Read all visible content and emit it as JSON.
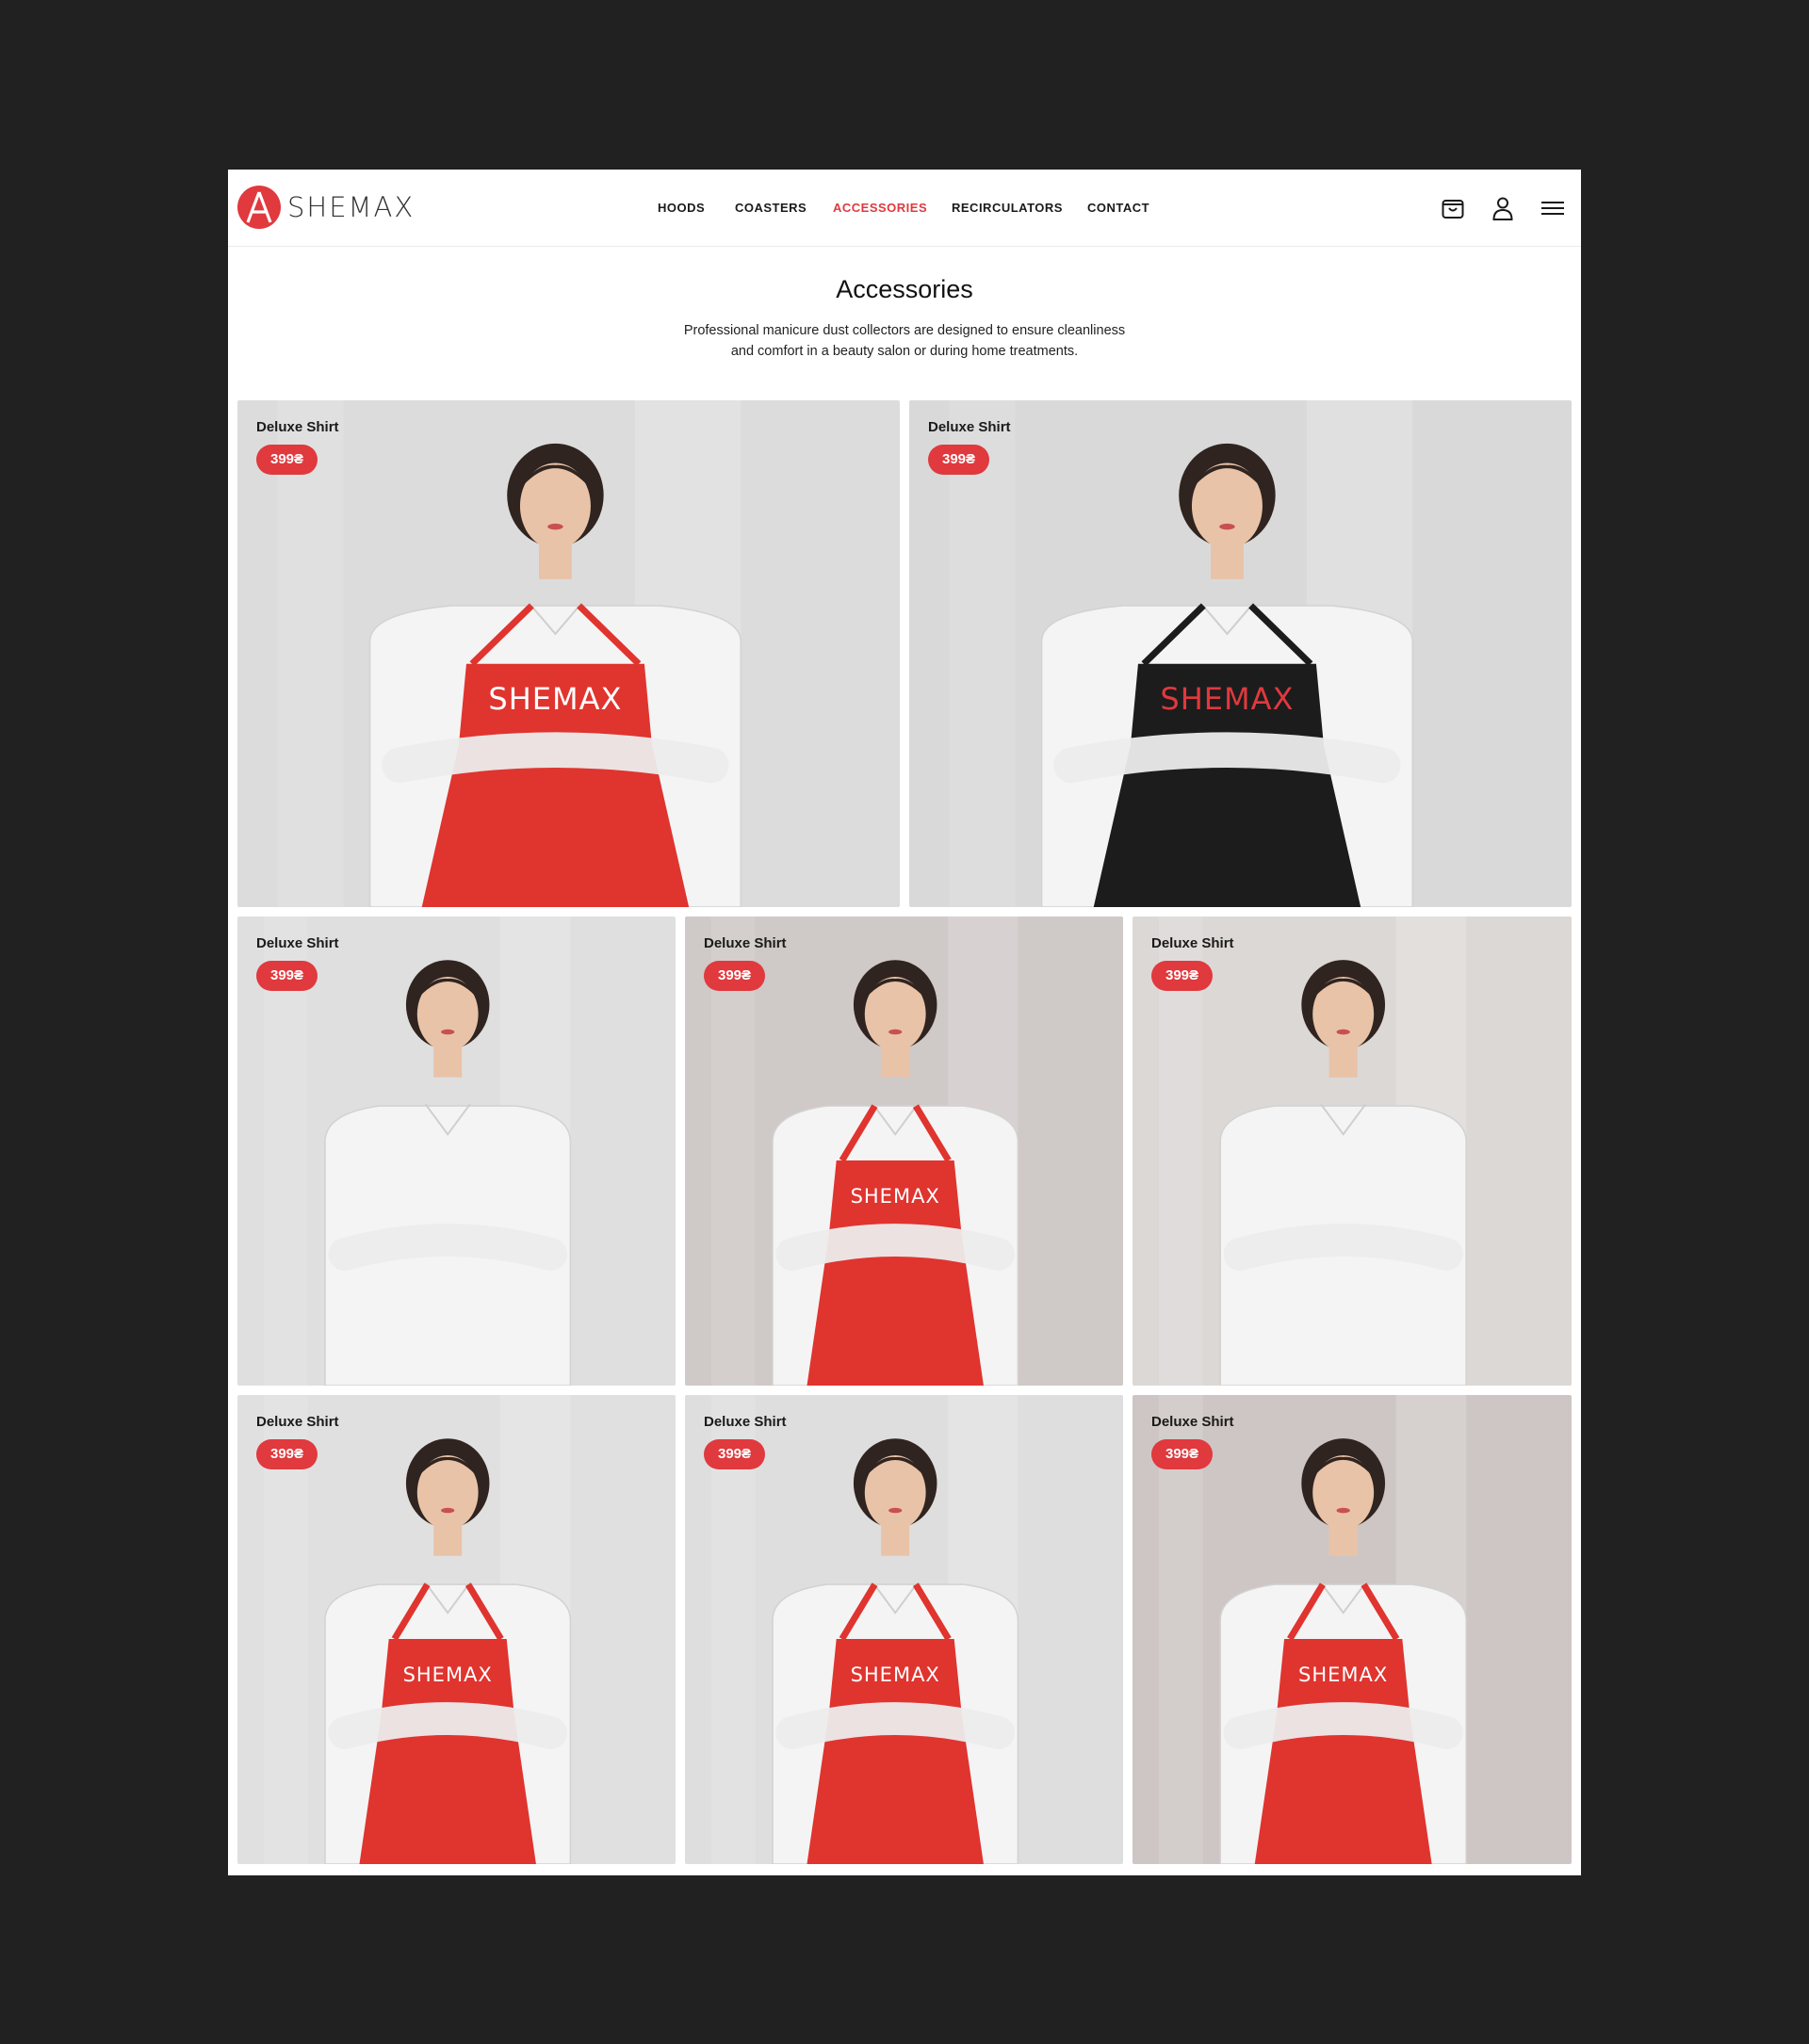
{
  "brand": {
    "name": "SHEMAX",
    "accent": "#e0393e"
  },
  "nav": {
    "items": [
      {
        "label": "HOODS",
        "active": false
      },
      {
        "label": "COASTERS",
        "active": false
      },
      {
        "label": "ACCESSORIES",
        "active": true
      },
      {
        "label": "RECIRCULATORS",
        "active": false
      },
      {
        "label": "CONTACT",
        "active": false
      }
    ]
  },
  "header_icons": [
    "cart-icon",
    "user-icon",
    "menu-icon"
  ],
  "page": {
    "title": "Accessories",
    "subtitle_line1": "Professional manicure dust collectors are designed to ensure cleanliness",
    "subtitle_line2": "and comfort in a beauty salon or during home treatments."
  },
  "products": [
    {
      "name": "Deluxe Shirt",
      "price": "399₴",
      "apron": "red"
    },
    {
      "name": "Deluxe Shirt",
      "price": "399₴",
      "apron": "black"
    },
    {
      "name": "Deluxe Shirt",
      "price": "399₴",
      "apron": "none"
    },
    {
      "name": "Deluxe Shirt",
      "price": "399₴",
      "apron": "red"
    },
    {
      "name": "Deluxe Shirt",
      "price": "399₴",
      "apron": "none"
    },
    {
      "name": "Deluxe Shirt",
      "price": "399₴",
      "apron": "red"
    },
    {
      "name": "Deluxe Shirt",
      "price": "399₴",
      "apron": "red"
    },
    {
      "name": "Deluxe Shirt",
      "price": "399₴",
      "apron": "red"
    }
  ]
}
